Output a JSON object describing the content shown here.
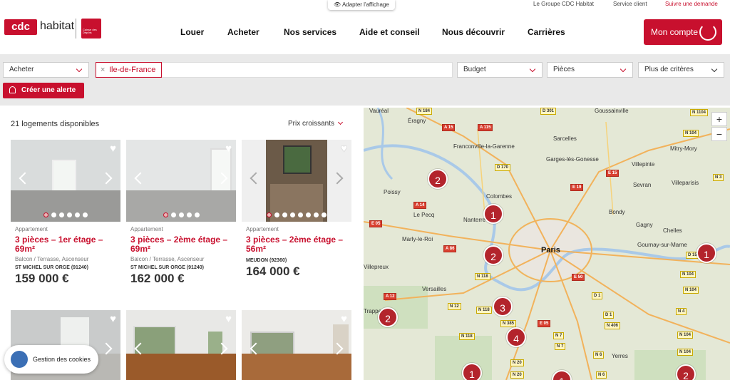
{
  "topbar": {
    "adapt_label": "Adapter l'affichage",
    "groupe": "Le Groupe CDC Habitat",
    "service": "Service client",
    "demande": "Suivre une demande"
  },
  "brand": {
    "logo_mark": "cdc",
    "logo_word": "habitat",
    "partner_text": "Caisse des Dépôts"
  },
  "nav": [
    "Louer",
    "Acheter",
    "Nos services",
    "Aide et conseil",
    "Nous découvrir",
    "Carrières"
  ],
  "account_label": "Mon compte",
  "filters": {
    "mode": "Acheter",
    "location_tag": "Ile-de-France",
    "budget": "Budget",
    "rooms": "Pièces",
    "more": "Plus de critères",
    "alert_button": "Créer une alerte"
  },
  "results": {
    "count_label": "21 logements disponibles",
    "sort_label": "Prix croissants"
  },
  "listings": [
    {
      "type": "Appartement",
      "title": "3 pièces – 1er étage – 69m²",
      "features": "Balcon / Terrasse, Ascenseur",
      "city": "ST MICHEL SUR ORGE (91240)",
      "price": "159 000 €",
      "photo_count": 6,
      "active_photo": 0
    },
    {
      "type": "Appartement",
      "title": "3 pièces – 2ème étage – 69m²",
      "features": "Balcon / Terrasse, Ascenseur",
      "city": "ST MICHEL SUR ORGE (91240)",
      "price": "162 000 €",
      "photo_count": 5,
      "active_photo": 0
    },
    {
      "type": "Appartement",
      "title": "3 pièces – 2ème étage – 56m²",
      "features": "",
      "city": "MEUDON (92360)",
      "price": "164 000 €",
      "photo_count": 8,
      "active_photo": 0
    }
  ],
  "cookie_label": "Gestion des cookies",
  "map": {
    "zoom_in": "+",
    "zoom_out": "−",
    "places": [
      "Vauréal",
      "Éragny",
      "Goussainville",
      "Sarcelles",
      "Franconville-la-Garenne",
      "Garges-lès-Gonesse",
      "Mitry-Mory",
      "Villepinte",
      "Poissy",
      "Colombes",
      "Sevran",
      "Villeparisis",
      "Le Pecq",
      "Bondy",
      "Nanterre",
      "Gagny",
      "Chelles",
      "Marly-le-Roi",
      "Gournay-sur-Marne",
      "Paris",
      "Villepreux",
      "Versailles",
      "Trappes",
      "Yerres"
    ],
    "roads": [
      "N 184",
      "D 301",
      "N 1104",
      "A 15",
      "A 115",
      "N 104",
      "D 170",
      "E 15",
      "N 3",
      "E 19",
      "A 14",
      "E 05",
      "A 86",
      "N 118",
      "E 50",
      "N 104",
      "N 104",
      "D 1",
      "A 12",
      "N 12",
      "N 118",
      "D 1",
      "N 4",
      "N 385",
      "E 05",
      "N 406",
      "N 7",
      "N 104",
      "N 118",
      "N 7",
      "N 20",
      "N 6",
      "N 104",
      "N 20",
      "N 6",
      "D 15"
    ],
    "clusters": [
      "2",
      "1",
      "2",
      "1",
      "3",
      "2",
      "4",
      "1",
      "1",
      "2"
    ]
  }
}
